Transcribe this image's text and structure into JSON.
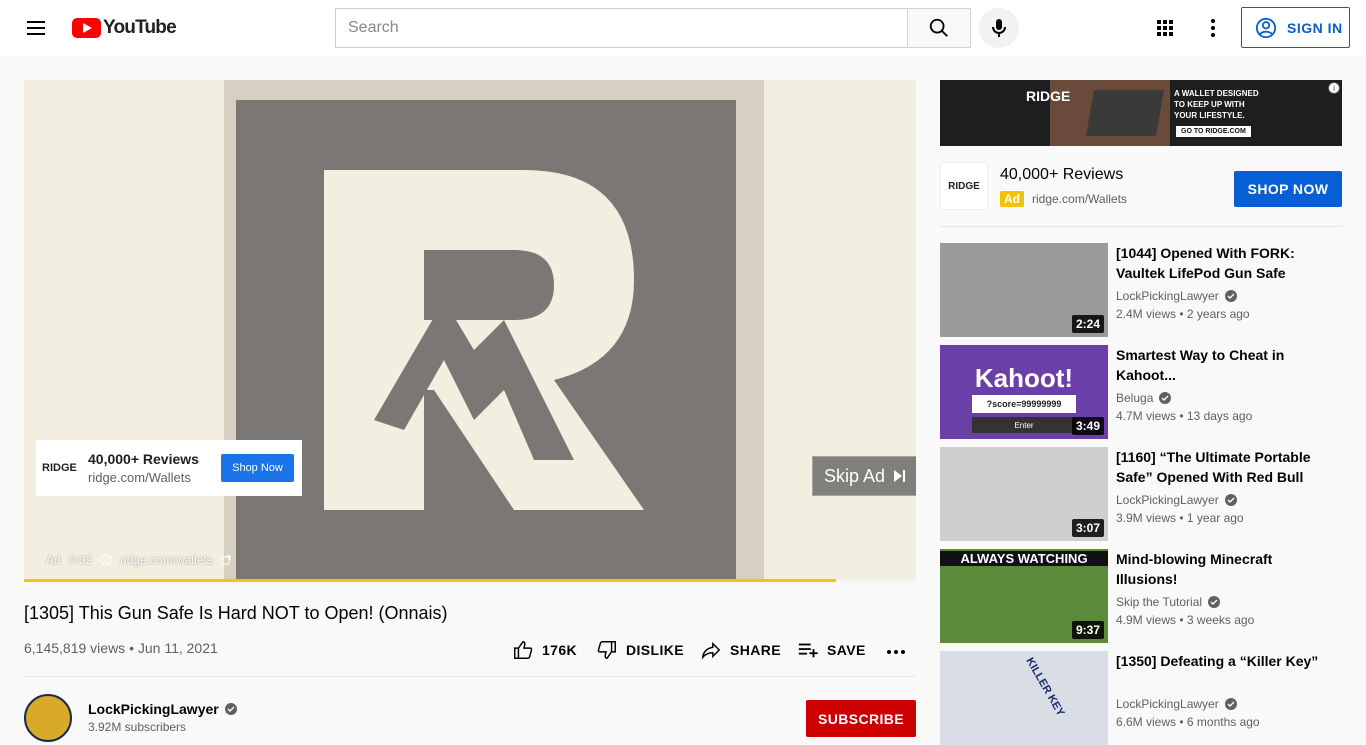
{
  "header": {
    "logo_text": "YouTube",
    "search_placeholder": "Search",
    "sign_in_label": "SIGN IN"
  },
  "player": {
    "progress_fraction": 0.91,
    "overlay_ad": {
      "logo_text": "RIDGE",
      "title": "40,000+ Reviews",
      "url": "ridge.com/Wallets",
      "button": "Shop Now"
    },
    "skip_ad_label": "Skip Ad",
    "ad_label": "Ad",
    "ad_time": "0:02",
    "ad_url": "ridge.com/wallets"
  },
  "video": {
    "title": "[1305] This Gun Safe Is Hard NOT to Open! (Onnais)",
    "views_date": "6,145,819 views • Jun 11, 2021",
    "likes": "176K",
    "dislike_label": "DISLIKE",
    "share_label": "SHARE",
    "save_label": "SAVE"
  },
  "channel": {
    "name": "LockPickingLawyer",
    "subscribers": "3.92M subscribers",
    "subscribe_label": "SUBSCRIBE"
  },
  "sidebar_ad": {
    "banner_brand": "RIDGE",
    "banner_copy": "A WALLET DESIGNED TO KEEP UP WITH YOUR LIFESTYLE.",
    "banner_cta": "GO TO RIDGE.COM",
    "logo_text": "RIDGE",
    "title": "40,000+ Reviews",
    "badge": "Ad",
    "url": "ridge.com/Wallets",
    "button": "SHOP NOW"
  },
  "recommendations": [
    {
      "title": "[1044] Opened With FORK: Vaultek LifePod Gun Safe",
      "channel": "LockPickingLawyer",
      "meta": "2.4M views • 2 years ago",
      "duration": "2:24",
      "thumb_color": "#9a9a9a"
    },
    {
      "title": "Smartest Way to Cheat in Kahoot...",
      "channel": "Beluga",
      "meta": "4.7M views • 13 days ago",
      "duration": "3:49",
      "thumb_color": "#6a3fa8",
      "thumb_text": "Kahoot!",
      "thumb_sub": "?score=99999999",
      "thumb_btn": "Enter"
    },
    {
      "title": "[1160] “The Ultimate Portable Safe” Opened With Red Bull C...",
      "channel": "LockPickingLawyer",
      "meta": "3.9M views • 1 year ago",
      "duration": "3:07",
      "thumb_color": "#cfcfcf"
    },
    {
      "title": "Mind-blowing Minecraft Illusions!",
      "channel": "Skip the Tutorial",
      "meta": "4.9M views • 3 weeks ago",
      "duration": "9:37",
      "thumb_color": "#5a8a3a",
      "thumb_text": "ALWAYS WATCHING"
    },
    {
      "title": "[1350] Defeating a “Killer Key”",
      "channel": "LockPickingLawyer",
      "meta": "6.6M views • 6 months ago",
      "duration": "",
      "thumb_color": "#d8dde6",
      "thumb_text": "KILLER KEY"
    }
  ]
}
